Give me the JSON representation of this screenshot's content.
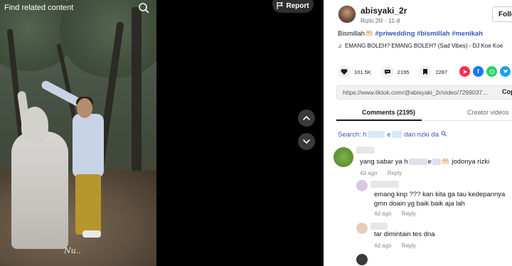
{
  "video": {
    "find_related": "Find related content",
    "report_label": "Report",
    "watermark": "Nu.."
  },
  "author": {
    "username": "abisyaki_2r",
    "display_name": "Rizki 2R",
    "date": "11-8",
    "separator": "·",
    "follow_label": "Follo"
  },
  "caption": {
    "text": "Bismillah🤲🏻",
    "hashtags": [
      "#priwedding",
      "#bismillah",
      "#menikah"
    ]
  },
  "music": {
    "title": "EMANG BOLEH? EMANG BOLEH? (Sad Vibes) - DJ Koe Koe"
  },
  "actions": {
    "likes": "101.5K",
    "comments": "2195",
    "saves": "2287"
  },
  "share_colors": {
    "primary": "#fe2c55",
    "facebook": "#1877f2",
    "whatsapp": "#25d366",
    "twitter": "#1da1f2"
  },
  "url": {
    "value": "https://www.tiktok.com/@abisyaki_2r/video/7299037...",
    "copy_label": "Cop"
  },
  "tabs": {
    "comments": "Comments (2195)",
    "creator": "Creator videos"
  },
  "search": {
    "label": "Search:",
    "query_start": "h",
    "query_mid": "e",
    "query_end": "dan rizki da",
    "icon": "search-icon"
  },
  "comments": [
    {
      "text_start": "yang sabar ya h",
      "text_mid": "e",
      "text_end": "🤲🏻 jodonya rizki",
      "time": "4d ago",
      "reply": "Reply"
    },
    {
      "text": "emang knp ??? kan kita ga tau kedepannya",
      "text2": "gmn doain yg baik baik aja lah",
      "time": "4d ago",
      "reply": "Reply"
    },
    {
      "text": "tar dimintain tes dna",
      "time": "4d ago",
      "reply": "Reply"
    }
  ]
}
